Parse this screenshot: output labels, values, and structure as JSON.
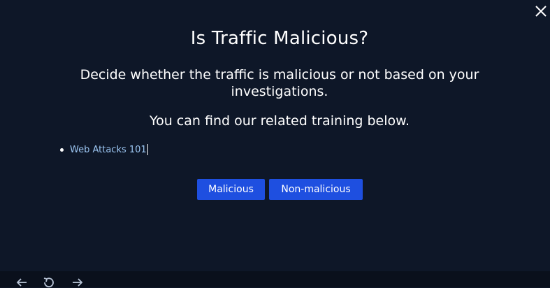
{
  "modal": {
    "title": "Is Traffic Malicious?",
    "description": "Decide whether the traffic is malicious or not based on your investigations.",
    "training_intro": "You can find our related training below.",
    "trainings": [
      {
        "label": "Web Attacks 101"
      }
    ],
    "buttons": {
      "malicious": "Malicious",
      "non_malicious": "Non-malicious"
    },
    "close_icon": "close-icon"
  },
  "bottom_bar": {
    "icons": [
      "arrow-left-icon",
      "undo-icon",
      "arrow-right-icon"
    ]
  },
  "colors": {
    "background": "#0e1728",
    "button": "#1e4fe0",
    "link": "#9cc6f2"
  }
}
